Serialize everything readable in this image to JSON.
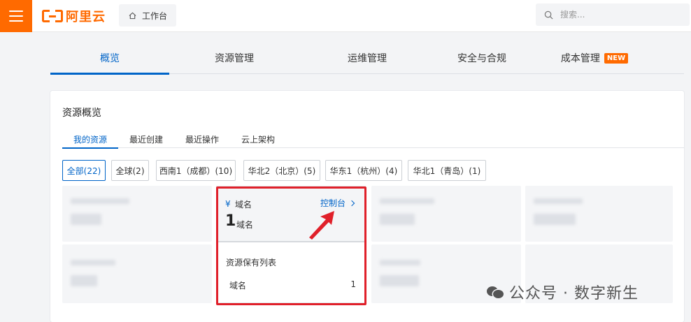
{
  "topbar": {
    "brand": "阿里云",
    "workbench_label": "工作台",
    "search_placeholder": "搜索..."
  },
  "main_tabs": [
    {
      "label": "概览",
      "active": true
    },
    {
      "label": "资源管理",
      "active": false
    },
    {
      "label": "运维管理",
      "active": false
    },
    {
      "label": "安全与合规",
      "active": false
    },
    {
      "label": "成本管理",
      "badge": "NEW",
      "active": false
    }
  ],
  "overview": {
    "title": "资源概览",
    "sub_tabs": [
      {
        "label": "我的资源",
        "active": true
      },
      {
        "label": "最近创建",
        "active": false
      },
      {
        "label": "最近操作",
        "active": false
      },
      {
        "label": "云上架构",
        "active": false
      }
    ],
    "region_filters": [
      {
        "label": "全部(22)",
        "active": true
      },
      {
        "label": "全球(2)",
        "active": false
      },
      {
        "label": "西南1（成都）(10)",
        "active": false
      },
      {
        "label": "华北2（北京）(5)",
        "active": false
      },
      {
        "label": "华东1（杭州）(4)",
        "active": false
      },
      {
        "label": "华北1（青岛）(1)",
        "active": false
      }
    ],
    "domain_card": {
      "icon": "domain-icon",
      "label": "域名",
      "console_link": "控制台",
      "count": "1",
      "unit": "域名",
      "list_title": "资源保有列表",
      "rows": [
        {
          "label": "域名",
          "value": "1"
        }
      ]
    }
  },
  "watermark": {
    "text": "公众号 · 数字新生"
  },
  "colors": {
    "brand_orange": "#ff6a00",
    "link_blue": "#0064c8",
    "highlight_red": "#e0202a"
  }
}
